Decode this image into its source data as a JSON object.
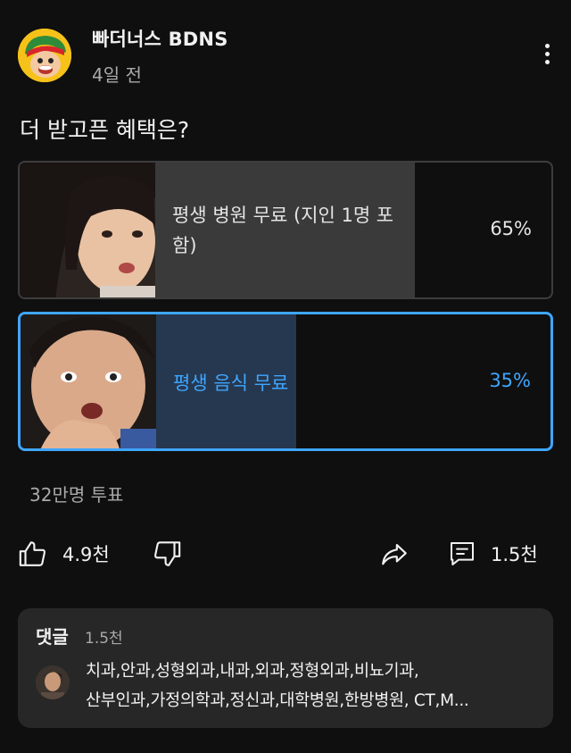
{
  "header": {
    "channel_name": "빠더너스 BDNS",
    "time": "4일 전",
    "avatar_icon": "mascot-avatar-icon",
    "menu_icon": "more-vertical-icon"
  },
  "poll": {
    "question": "더 받고픈 혜택은?",
    "options": [
      {
        "label": "평생 병원 무료 (지인 1명 포함)",
        "percent_text": "65%",
        "percent": 65,
        "selected": false
      },
      {
        "label": "평생 음식 무료",
        "percent_text": "35%",
        "percent": 35,
        "selected": true
      }
    ],
    "votes": "32만명 투표"
  },
  "actions": {
    "like_count": "4.9천",
    "comment_count": "1.5천",
    "icons": [
      "thumbs-up-icon",
      "thumbs-down-icon",
      "share-icon",
      "comment-icon"
    ]
  },
  "comments": {
    "heading": "댓글",
    "count": "1.5천",
    "preview_line1": "치과,안과,성형외과,내과,외과,정형외과,비뇨기과,",
    "preview_line2": "산부인과,가정의학과,정신과,대학병원,한방병원, CT,M..."
  },
  "colors": {
    "background": "#0f0f0f",
    "accent": "#3ea6ff",
    "card": "#272727",
    "secondary_text": "#aaaaaa"
  }
}
